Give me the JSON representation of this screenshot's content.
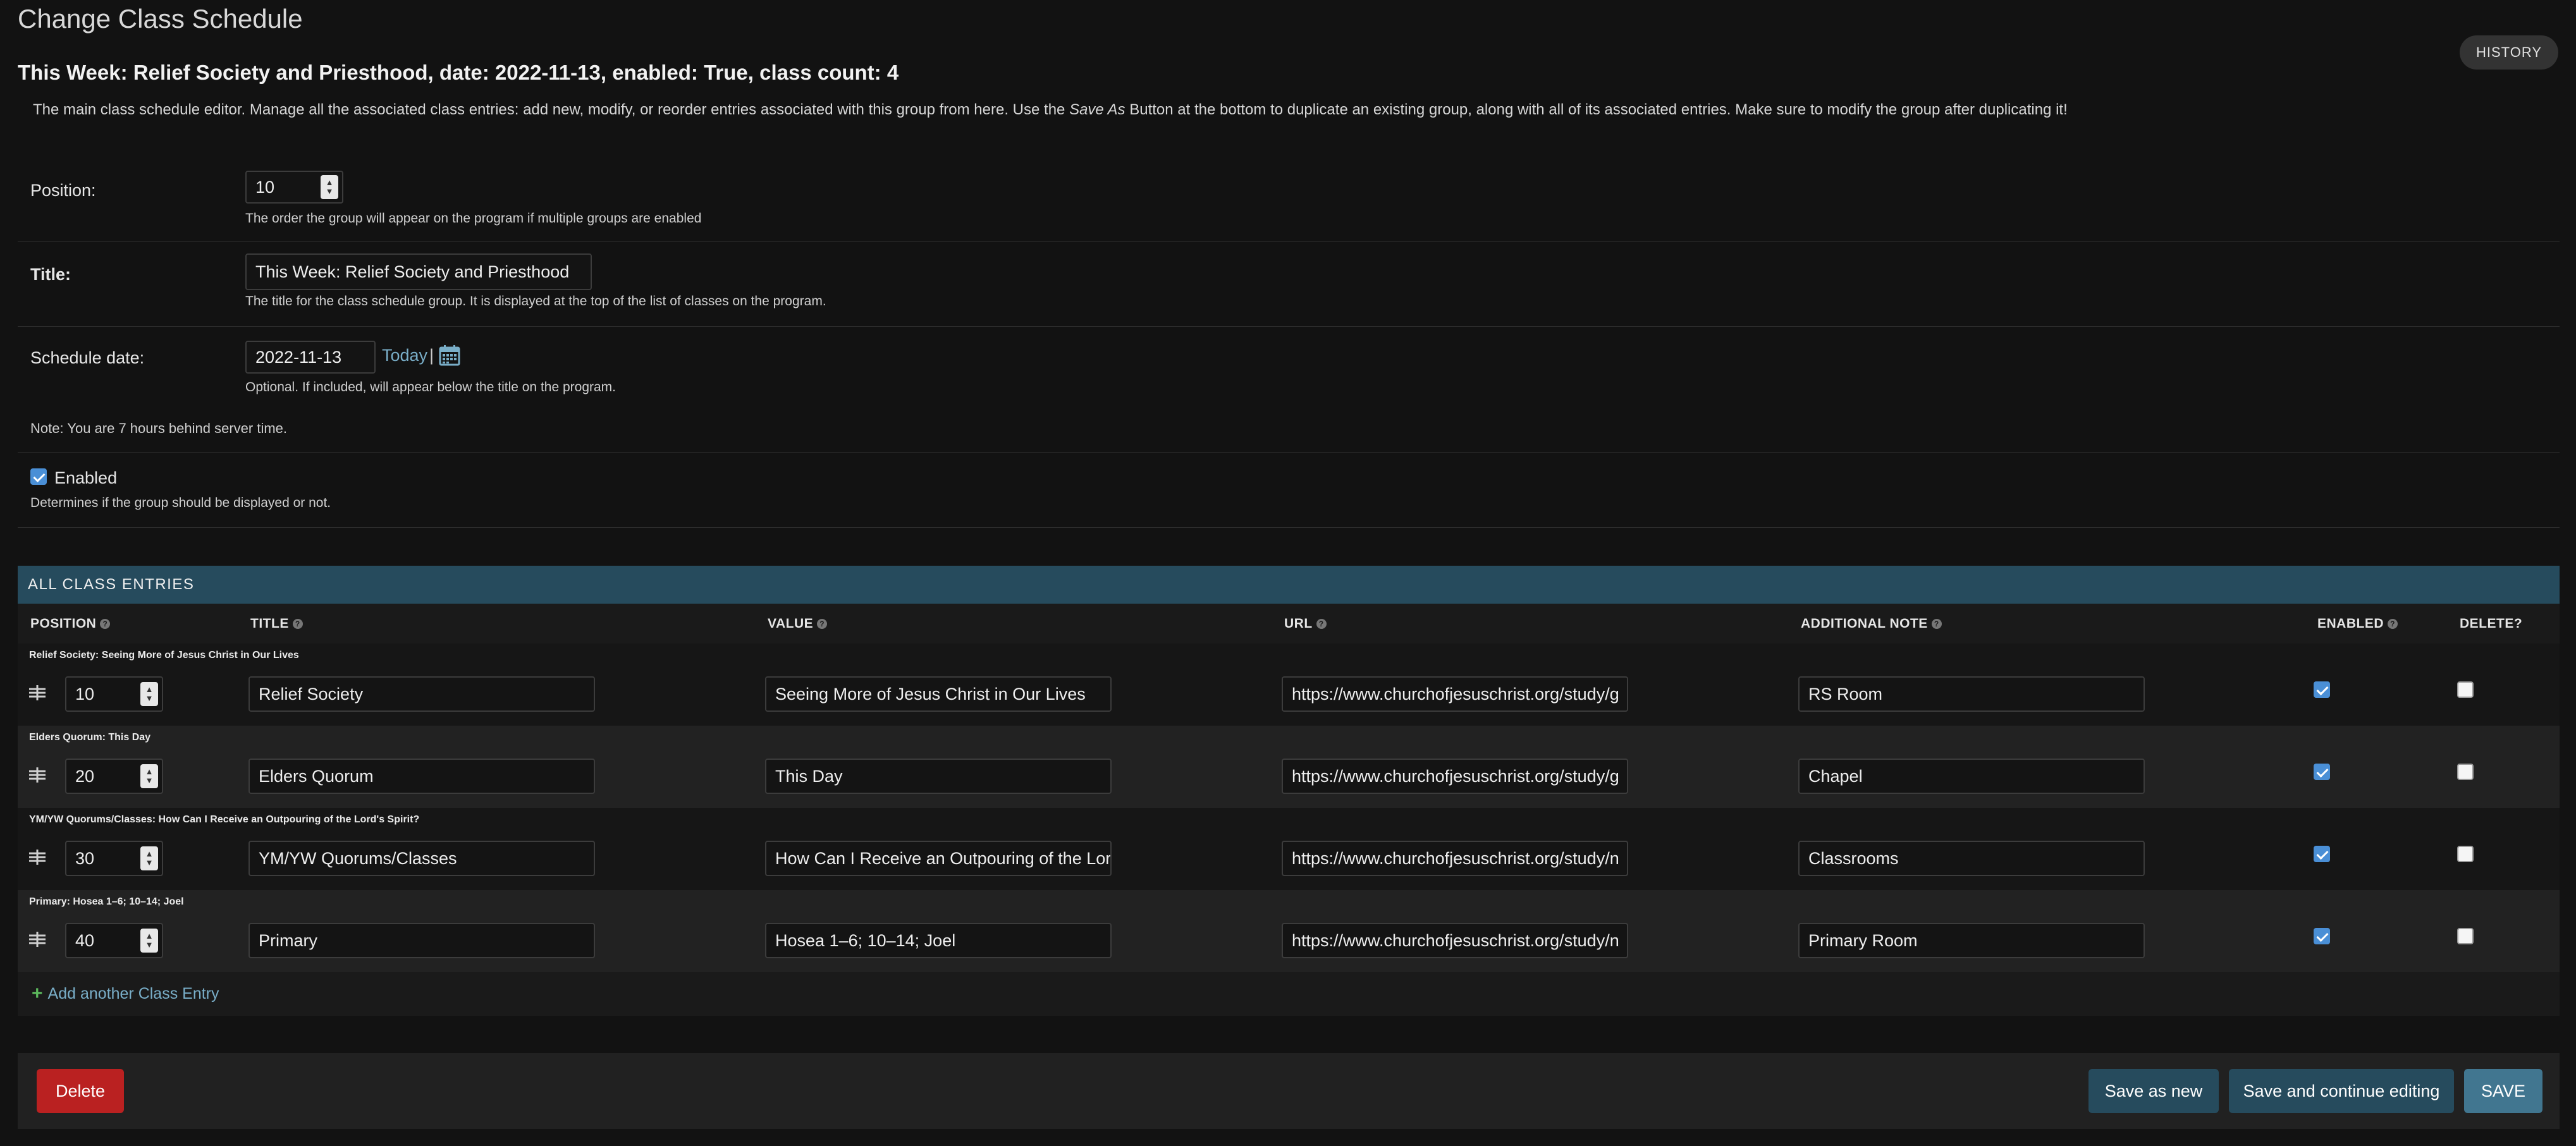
{
  "header": {
    "title": "Change Class Schedule",
    "history_label": "HISTORY",
    "object_title": "This Week: Relief Society and Priesthood, date: 2022-11-13, enabled: True, class count: 4"
  },
  "description": {
    "before": "The main class schedule editor. Manage all the associated class entries: add new, modify, or reorder entries associated with this group from here. Use the ",
    "emphasis": "Save As",
    "after": " Button at the bottom to duplicate an existing group, along with all of its associated entries. Make sure to modify the group after duplicating it!"
  },
  "fields": {
    "position": {
      "label": "Position:",
      "value": "10",
      "help": "The order the group will appear on the program if multiple groups are enabled"
    },
    "title": {
      "label": "Title:",
      "value": "This Week: Relief Society and Priesthood",
      "help": "The title for the class schedule group. It is displayed at the top of the list of classes on the program."
    },
    "schedule_date": {
      "label": "Schedule date:",
      "value": "2022-11-13",
      "today_label": "Today",
      "separator": "|",
      "help": "Optional. If included, will appear below the title on the program."
    },
    "timezone_note": "Note: You are 7 hours behind server time.",
    "enabled": {
      "label": "Enabled",
      "checked": true,
      "help": "Determines if the group should be displayed or not."
    }
  },
  "inline": {
    "heading": "ALL CLASS ENTRIES",
    "columns": [
      "POSITION",
      "TITLE",
      "VALUE",
      "URL",
      "ADDITIONAL NOTE",
      "ENABLED",
      "DELETE?"
    ],
    "entries": [
      {
        "caption": "Relief Society: Seeing More of Jesus Christ in Our Lives",
        "position": "10",
        "title": "Relief Society",
        "value": "Seeing More of Jesus Christ in Our Lives",
        "url": "https://www.churchofjesuschrist.org/study/g",
        "note": "RS Room",
        "enabled": true,
        "delete": false
      },
      {
        "caption": "Elders Quorum: This Day",
        "position": "20",
        "title": "Elders Quorum",
        "value": "This Day",
        "url": "https://www.churchofjesuschrist.org/study/g",
        "note": "Chapel",
        "enabled": true,
        "delete": false
      },
      {
        "caption": "YM/YW Quorums/Classes: How Can I Receive an Outpouring of the Lord's Spirit?",
        "position": "30",
        "title": "YM/YW Quorums/Classes",
        "value": "How Can I Receive an Outpouring of the Lord'",
        "url": "https://www.churchofjesuschrist.org/study/n",
        "note": "Classrooms",
        "enabled": true,
        "delete": false
      },
      {
        "caption": "Primary: Hosea 1–6; 10–14; Joel",
        "position": "40",
        "title": "Primary",
        "value": "Hosea 1–6; 10–14; Joel",
        "url": "https://www.churchofjesuschrist.org/study/n",
        "note": "Primary Room",
        "enabled": true,
        "delete": false
      }
    ],
    "add_label": "Add another Class Entry"
  },
  "actions": {
    "delete_label": "Delete",
    "save_as_new_label": "Save as new",
    "save_continue_label": "Save and continue editing",
    "save_label": "SAVE"
  },
  "colors": {
    "header_bar": "#264b5d",
    "link": "#79aec8",
    "delete": "#ba2121",
    "save": "#417690",
    "checkbox": "#4a8fd6"
  }
}
